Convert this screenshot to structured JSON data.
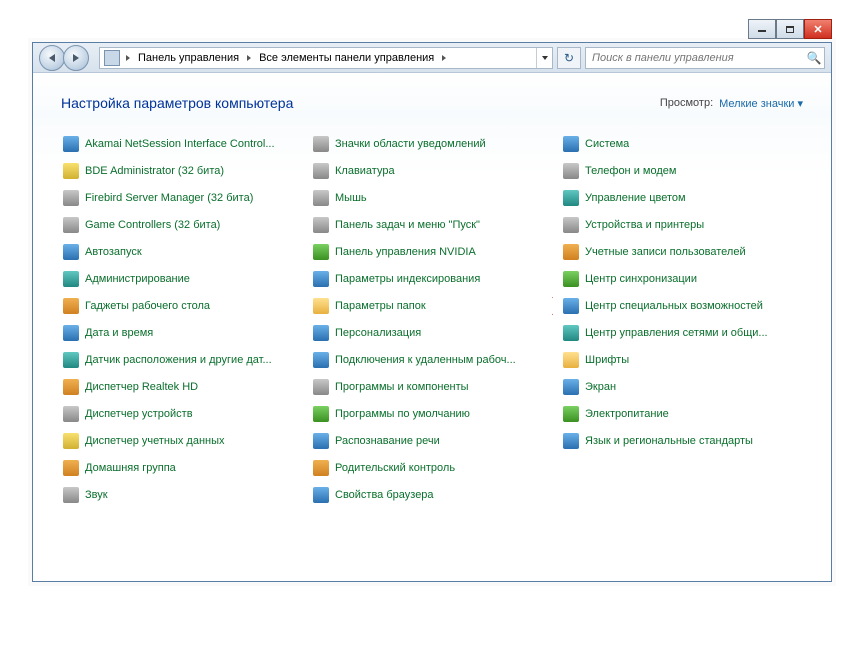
{
  "breadcrumb": {
    "level1": "Панель управления",
    "level2": "Все элементы панели управления"
  },
  "search": {
    "placeholder": "Поиск в панели управления"
  },
  "header": {
    "title": "Настройка параметров компьютера",
    "view_label": "Просмотр:",
    "view_value": "Мелкие значки"
  },
  "items": [
    {
      "label": "Akamai NetSession Interface Control...",
      "ic": "ic-blue"
    },
    {
      "label": "BDE Administrator (32 бита)",
      "ic": "ic-yellow"
    },
    {
      "label": "Firebird Server Manager (32 бита)",
      "ic": "ic-gray"
    },
    {
      "label": "Game Controllers (32 бита)",
      "ic": "ic-gray"
    },
    {
      "label": "Автозапуск",
      "ic": "ic-blue"
    },
    {
      "label": "Администрирование",
      "ic": "ic-teal"
    },
    {
      "label": "Гаджеты рабочего стола",
      "ic": "ic-orange"
    },
    {
      "label": "Дата и время",
      "ic": "ic-blue"
    },
    {
      "label": "Датчик расположения и другие дат...",
      "ic": "ic-teal"
    },
    {
      "label": "Диспетчер Realtek HD",
      "ic": "ic-orange"
    },
    {
      "label": "Диспетчер устройств",
      "ic": "ic-gray"
    },
    {
      "label": "Диспетчер учетных данных",
      "ic": "ic-yellow"
    },
    {
      "label": "Домашняя группа",
      "ic": "ic-orange"
    },
    {
      "label": "Звук",
      "ic": "ic-gray"
    },
    {
      "label": "Значки области уведомлений",
      "ic": "ic-gray"
    },
    {
      "label": "Клавиатура",
      "ic": "ic-gray"
    },
    {
      "label": "Мышь",
      "ic": "ic-gray"
    },
    {
      "label": "Панель задач и меню \"Пуск\"",
      "ic": "ic-gray"
    },
    {
      "label": "Панель управления NVIDIA",
      "ic": "ic-green"
    },
    {
      "label": "Параметры индексирования",
      "ic": "ic-blue"
    },
    {
      "label": "Параметры папок",
      "ic": "ic-folder",
      "hl": true
    },
    {
      "label": "Персонализация",
      "ic": "ic-blue"
    },
    {
      "label": "Подключения к удаленным рабоч...",
      "ic": "ic-blue"
    },
    {
      "label": "Программы и компоненты",
      "ic": "ic-gray"
    },
    {
      "label": "Программы по умолчанию",
      "ic": "ic-green"
    },
    {
      "label": "Распознавание речи",
      "ic": "ic-blue"
    },
    {
      "label": "Родительский контроль",
      "ic": "ic-orange"
    },
    {
      "label": "Свойства браузера",
      "ic": "ic-blue"
    },
    {
      "label": "Система",
      "ic": "ic-blue"
    },
    {
      "label": "Телефон и модем",
      "ic": "ic-gray"
    },
    {
      "label": "Управление цветом",
      "ic": "ic-teal"
    },
    {
      "label": "Устройства и принтеры",
      "ic": "ic-gray"
    },
    {
      "label": "Учетные записи пользователей",
      "ic": "ic-orange"
    },
    {
      "label": "Центр синхронизации",
      "ic": "ic-green"
    },
    {
      "label": "Центр специальных возможностей",
      "ic": "ic-blue"
    },
    {
      "label": "Центр управления сетями и общи...",
      "ic": "ic-teal"
    },
    {
      "label": "Шрифты",
      "ic": "ic-folder"
    },
    {
      "label": "Экран",
      "ic": "ic-blue"
    },
    {
      "label": "Электропитание",
      "ic": "ic-green"
    },
    {
      "label": "Язык и региональные стандарты",
      "ic": "ic-blue"
    }
  ]
}
